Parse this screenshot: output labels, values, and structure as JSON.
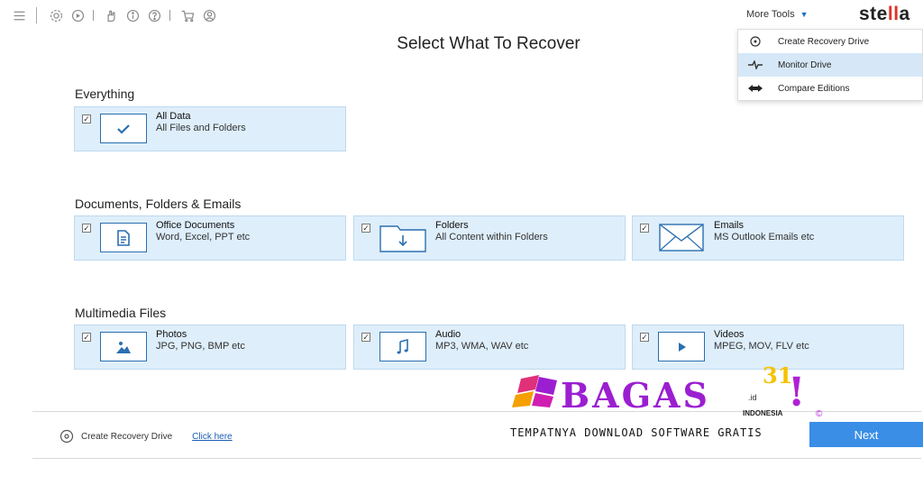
{
  "toolbar": {
    "icons": [
      "hamburger-icon",
      "gear-icon",
      "scan-icon",
      "hand-icon",
      "info-icon",
      "help-icon",
      "cart-icon",
      "user-icon"
    ]
  },
  "more_tools": {
    "label": "More Tools",
    "items": [
      {
        "label": "Create Recovery Drive",
        "icon": "recovery-drive-icon"
      },
      {
        "label": "Monitor Drive",
        "icon": "monitor-drive-icon",
        "highlighted": true
      },
      {
        "label": "Compare Editions",
        "icon": "compare-editions-icon"
      }
    ]
  },
  "brand": {
    "prefix": "ste",
    "accent": "ll",
    "suffix": "a",
    "accent_color": "#e03224"
  },
  "page_title": "Select What To Recover",
  "sections": [
    {
      "label": "Everything",
      "cards": [
        {
          "title": "All Data",
          "subtitle": "All Files and Folders",
          "icon": "check-icon",
          "checked": true
        }
      ]
    },
    {
      "label": "Documents, Folders & Emails",
      "cards": [
        {
          "title": "Office Documents",
          "subtitle": "Word, Excel, PPT etc",
          "icon": "document-icon",
          "checked": true
        },
        {
          "title": "Folders",
          "subtitle": "All Content within Folders",
          "icon": "folder-icon",
          "checked": true
        },
        {
          "title": "Emails",
          "subtitle": "MS Outlook Emails etc",
          "icon": "email-icon",
          "checked": true
        }
      ]
    },
    {
      "label": "Multimedia Files",
      "cards": [
        {
          "title": "Photos",
          "subtitle": "JPG, PNG, BMP etc",
          "icon": "photo-icon",
          "checked": true
        },
        {
          "title": "Audio",
          "subtitle": "MP3, WMA, WAV etc",
          "icon": "music-note-icon",
          "checked": true
        },
        {
          "title": "Videos",
          "subtitle": "MPEG, MOV, FLV etc",
          "icon": "play-icon",
          "checked": true
        }
      ]
    }
  ],
  "footer": {
    "recovery_label": "Create Recovery Drive",
    "link_label": "Click here",
    "next_label": "Next"
  },
  "watermark": {
    "main": "BAGAS",
    "number": "31",
    "domain": ".id",
    "country": "INDONESIA",
    "mark": "!",
    "copyright": "©",
    "tagline": "TEMPATNYA DOWNLOAD SOFTWARE GRATIS"
  },
  "colors": {
    "accent": "#3a8ee6",
    "card_bg": "#deeefb",
    "icon_border": "#2a6fb0",
    "watermark": "#9b1fd1"
  }
}
